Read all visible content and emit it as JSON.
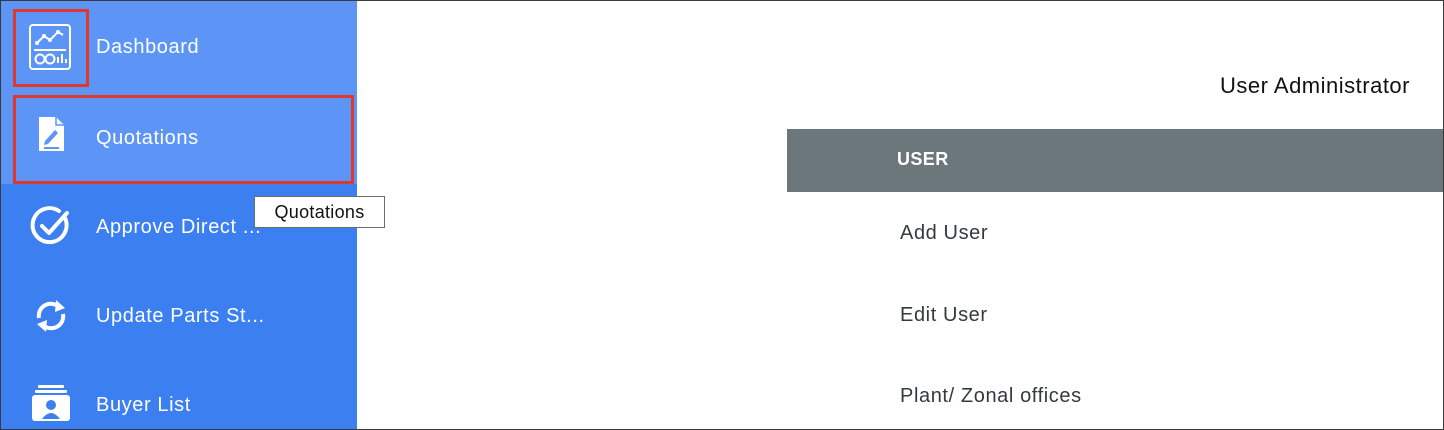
{
  "sidebar": {
    "items": [
      {
        "label": "Dashboard",
        "icon": "dashboard-icon"
      },
      {
        "label": "Quotations",
        "icon": "document-edit-icon"
      },
      {
        "label": "Approve Direct ...",
        "icon": "check-circle-icon"
      },
      {
        "label": "Update Parts St...",
        "icon": "refresh-icon"
      },
      {
        "label": "Buyer List",
        "icon": "contact-card-icon"
      }
    ],
    "active_index": 1
  },
  "tooltip": {
    "text": "Quotations"
  },
  "main": {
    "title": "User Administrator",
    "table_header": "USER",
    "menu": [
      "Add User",
      "Edit User",
      "Plant/ Zonal offices"
    ]
  },
  "colors": {
    "sidebar_bg": "#3b7ff0",
    "sidebar_active_bg": "#5d95f7",
    "header_bg": "#6c777b",
    "highlight_border": "#e0382c"
  }
}
